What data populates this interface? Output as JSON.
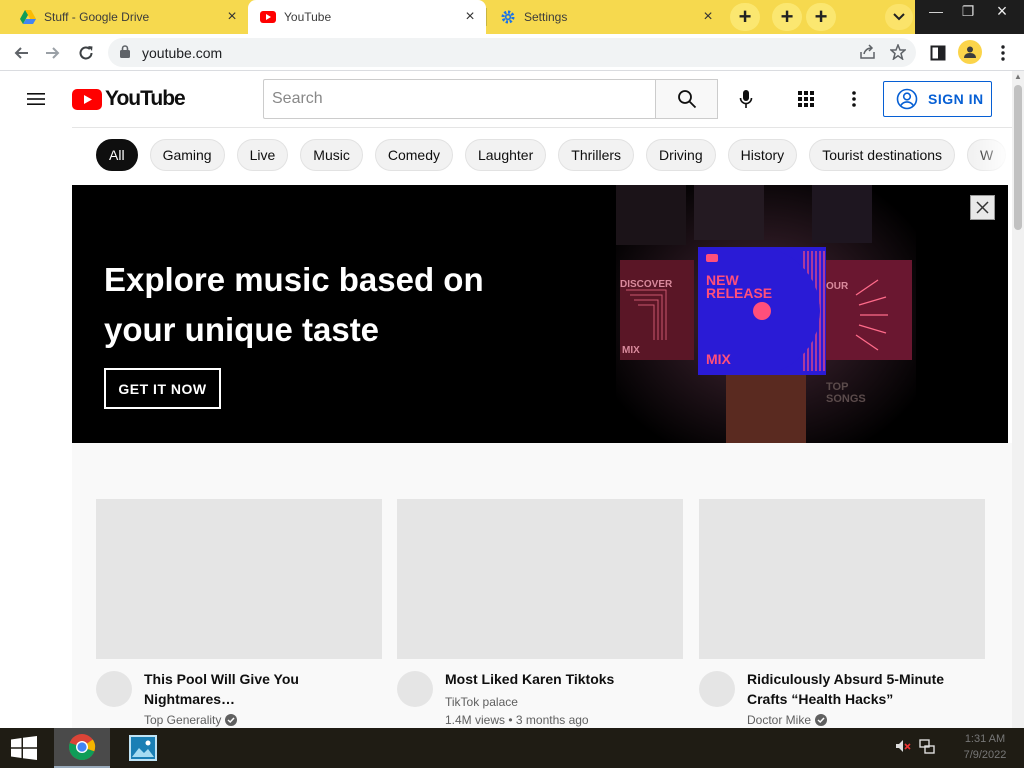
{
  "browser": {
    "tabs": [
      {
        "title": "Stuff - Google Drive",
        "icon": "google-drive-icon"
      },
      {
        "title": "YouTube",
        "icon": "youtube-icon",
        "active": true
      },
      {
        "title": "Settings",
        "icon": "settings-gear-icon"
      }
    ],
    "new_tab_symbol": "+",
    "url": "youtube.com"
  },
  "youtube": {
    "logo_text": "YouTube",
    "search_placeholder": "Search",
    "sign_in_label": "SIGN IN",
    "chips": [
      "All",
      "Gaming",
      "Live",
      "Music",
      "Comedy",
      "Laughter",
      "Thrillers",
      "Driving",
      "History",
      "Tourist destinations",
      "W"
    ],
    "banner": {
      "headline": "Explore music based on your unique taste",
      "cta": "GET IT NOW",
      "art_label_1": "NEW",
      "art_label_2": "RELEASE",
      "art_label_3": "MIX",
      "art_side_left": "DISCOVER",
      "art_side_right": "OUR",
      "art_side_mix": "MIX",
      "art_top": "TOP",
      "art_songs": "SONGS"
    },
    "videos": [
      {
        "title": "This Pool Will Give You Nightmares…",
        "channel": "Top Generality",
        "verified": true,
        "meta": ""
      },
      {
        "title": "Most Liked Karen Tiktoks",
        "channel": "TikTok palace",
        "verified": false,
        "meta": "1.4M views • 3 months ago"
      },
      {
        "title": "Ridiculously Absurd 5-Minute Crafts “Health Hacks”",
        "channel": "Doctor Mike",
        "verified": true,
        "meta": ""
      }
    ]
  },
  "taskbar": {
    "clock_time": "1:31 AM",
    "clock_date": "7/9/2022"
  },
  "colors": {
    "tabstrip": "#f6d94e",
    "youtube_red": "#ff0000",
    "link_blue": "#065fd4",
    "banner_bg": "#000000",
    "art_blue": "#2a1bd6",
    "art_pink": "#ff4f7b"
  }
}
